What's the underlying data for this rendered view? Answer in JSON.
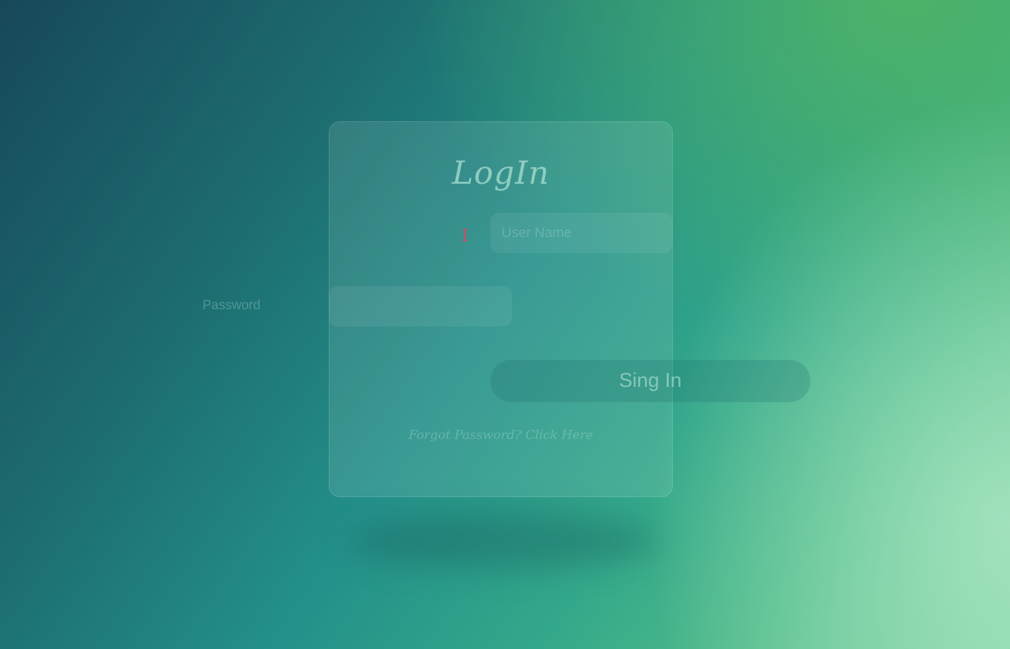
{
  "login": {
    "title": "LogIn",
    "username_placeholder": "User Name",
    "password_label": "Password",
    "password_placeholder": "",
    "signin_label": "Sing In",
    "forgot_link": "Forgot Password? Click Here",
    "text_cursor": "I"
  },
  "colors": {
    "background_start": "#17485a",
    "background_mid": "#24918a",
    "background_end": "#7dd0a0",
    "cursor": "#d84a66"
  }
}
